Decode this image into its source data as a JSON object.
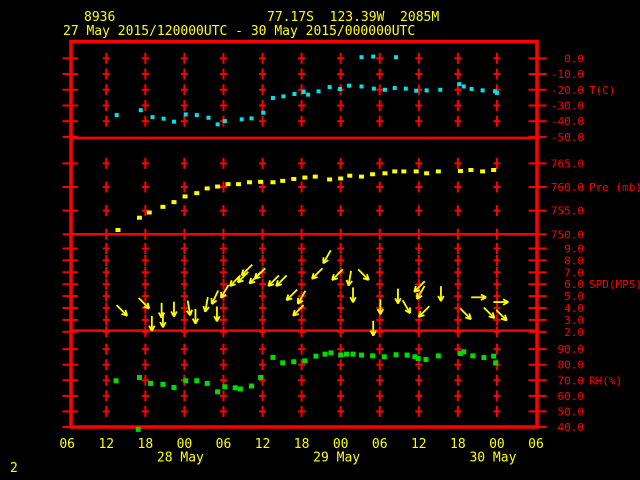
{
  "colors": {
    "background": "#000000",
    "grid": "#ff0000",
    "axis_text": "#ff0000",
    "label_text": "#ffff00",
    "temperature": "#00e1ea",
    "pressure": "#ffff00",
    "wind": "#ffff00",
    "humidity": "#00db00"
  },
  "chart_data": {
    "type": "scatter",
    "station_id": "8936",
    "location": "77.17S  123.39W  2085M",
    "period": "27 May 2015/120000UTC - 30 May 2015/000000UTC",
    "page_number": "2",
    "x_axis": {
      "hours_range": [
        0,
        72
      ],
      "tick_step_hours": 6,
      "tick_labels": [
        "06",
        "12",
        "18",
        "00",
        "06",
        "12",
        "18",
        "00",
        "06",
        "12",
        "18",
        "00",
        "06"
      ],
      "day_labels": [
        {
          "hour": 18,
          "label": "28 May"
        },
        {
          "hour": 42,
          "label": "29 May"
        },
        {
          "hour": 66,
          "label": "30 May"
        }
      ]
    },
    "panels": [
      {
        "name": "temperature",
        "unit_label": "T(C)",
        "unit_label_value": -20,
        "top_value": 10.7,
        "bottom_value": -50.6,
        "ticks": [
          {
            "label": "0.0",
            "value": 0
          },
          {
            "label": "-10.0",
            "value": -10
          },
          {
            "label": "-20.0",
            "value": -20
          },
          {
            "label": "-30.0",
            "value": -30
          },
          {
            "label": "-40.0",
            "value": -40
          },
          {
            "label": "-50.0",
            "value": -50
          }
        ],
        "grid_rows": [
          0,
          -10,
          -20,
          -30,
          -40
        ]
      },
      {
        "name": "pressure",
        "unit_label": "Pre (mb)",
        "unit_label_value": 760,
        "top_value": 770.4,
        "bottom_value": 750.0,
        "ticks": [
          {
            "label": "765.0",
            "value": 765
          },
          {
            "label": "760.0",
            "value": 760
          },
          {
            "label": "755.0",
            "value": 755
          },
          {
            "label": "750.0",
            "value": 750
          }
        ],
        "grid_rows": [
          765,
          760,
          755,
          750
        ]
      },
      {
        "name": "wind_speed",
        "unit_label": "SPD(MPS)",
        "unit_label_value": 6,
        "top_value": 10.2,
        "bottom_value": 2.1,
        "ticks": [
          {
            "label": "9.0",
            "value": 9
          },
          {
            "label": "8.0",
            "value": 8
          },
          {
            "label": "7.0",
            "value": 7
          },
          {
            "label": "6.0",
            "value": 6
          },
          {
            "label": "5.0",
            "value": 5
          },
          {
            "label": "4.0",
            "value": 4
          },
          {
            "label": "3.0",
            "value": 3
          },
          {
            "label": "2.0",
            "value": 2
          }
        ],
        "grid_rows": [
          9,
          8,
          7,
          6,
          5,
          4,
          3,
          2
        ]
      },
      {
        "name": "humidity",
        "unit_label": "RH(%)",
        "unit_label_value": 70,
        "top_value": 101.9,
        "bottom_value": 40.0,
        "ticks": [
          {
            "label": "90.0",
            "value": 90
          },
          {
            "label": "80.0",
            "value": 80
          },
          {
            "label": "70.0",
            "value": 70
          },
          {
            "label": "60.0",
            "value": 60
          },
          {
            "label": "50.0",
            "value": 50
          },
          {
            "label": "40.0",
            "value": 40
          }
        ],
        "grid_rows": [
          90,
          80,
          70,
          60,
          50
        ]
      }
    ],
    "series": {
      "temperature": {
        "panel": 0,
        "color": "#00e1ea",
        "marker": [
          4,
          4
        ],
        "points": [
          [
            7.6,
            -36.1
          ],
          [
            11.3,
            -33.0
          ],
          [
            13.1,
            -37.4
          ],
          [
            14.8,
            -38.4
          ],
          [
            16.4,
            -40.3
          ],
          [
            18.2,
            -35.7
          ],
          [
            19.9,
            -36.1
          ],
          [
            21.7,
            -37.8
          ],
          [
            23.1,
            -42.0
          ],
          [
            24.2,
            -39.9
          ],
          [
            26.8,
            -38.8
          ],
          [
            28.3,
            -38.2
          ],
          [
            30.1,
            -34.6
          ],
          [
            31.6,
            -25.2
          ],
          [
            33.2,
            -24.2
          ],
          [
            34.9,
            -22.7
          ],
          [
            36.3,
            -21.4
          ],
          [
            37.0,
            -23.1
          ],
          [
            38.6,
            -21.0
          ],
          [
            40.3,
            -18.3
          ],
          [
            41.9,
            -19.5
          ],
          [
            43.3,
            -17.4
          ],
          [
            45.2,
            -17.9
          ],
          [
            45.2,
            0.7
          ],
          [
            47.0,
            1.1
          ],
          [
            47.1,
            -19.3
          ],
          [
            48.8,
            -20.0
          ],
          [
            50.3,
            -18.9
          ],
          [
            50.5,
            0.7
          ],
          [
            52.0,
            -19.3
          ],
          [
            53.6,
            -20.6
          ],
          [
            55.2,
            -20.4
          ],
          [
            57.3,
            -20.0
          ],
          [
            60.2,
            -16.4
          ],
          [
            60.9,
            -17.9
          ],
          [
            62.1,
            -19.5
          ],
          [
            63.8,
            -20.4
          ],
          [
            65.7,
            -21.0
          ],
          [
            66.0,
            -22.0
          ]
        ]
      },
      "pressure": {
        "panel": 1,
        "color": "#ffff00",
        "marker": [
          5,
          4
        ],
        "points": [
          [
            7.8,
            750.9
          ],
          [
            11.1,
            753.5
          ],
          [
            12.6,
            754.6
          ],
          [
            14.7,
            755.8
          ],
          [
            16.4,
            756.8
          ],
          [
            18.1,
            758.0
          ],
          [
            19.9,
            758.7
          ],
          [
            21.5,
            759.7
          ],
          [
            23.1,
            760.1
          ],
          [
            24.7,
            760.6
          ],
          [
            26.3,
            760.6
          ],
          [
            28.0,
            761.0
          ],
          [
            29.7,
            761.1
          ],
          [
            31.6,
            761.0
          ],
          [
            33.1,
            761.3
          ],
          [
            34.8,
            761.7
          ],
          [
            36.5,
            762.0
          ],
          [
            38.1,
            762.2
          ],
          [
            40.3,
            761.6
          ],
          [
            42.0,
            761.8
          ],
          [
            43.4,
            762.4
          ],
          [
            45.2,
            762.2
          ],
          [
            46.9,
            762.7
          ],
          [
            48.8,
            762.9
          ],
          [
            50.3,
            763.3
          ],
          [
            51.7,
            763.3
          ],
          [
            53.6,
            763.3
          ],
          [
            55.2,
            762.9
          ],
          [
            57.0,
            763.3
          ],
          [
            60.4,
            763.4
          ],
          [
            62.0,
            763.6
          ],
          [
            63.8,
            763.3
          ],
          [
            65.5,
            763.6
          ]
        ]
      },
      "wind": {
        "panel": 2,
        "color": "#ffff00",
        "arrows": [
          [
            8.4,
            3.8,
            45
          ],
          [
            11.8,
            4.4,
            45
          ],
          [
            13.0,
            2.7,
            90
          ],
          [
            14.5,
            3.8,
            90
          ],
          [
            14.7,
            3.0,
            90
          ],
          [
            16.4,
            3.9,
            90
          ],
          [
            18.7,
            4.0,
            80
          ],
          [
            19.7,
            3.3,
            90
          ],
          [
            21.4,
            4.3,
            100
          ],
          [
            22.7,
            4.9,
            115
          ],
          [
            23.0,
            3.5,
            90
          ],
          [
            24.2,
            5.4,
            120
          ],
          [
            25.8,
            6.3,
            135
          ],
          [
            27.0,
            6.6,
            135
          ],
          [
            27.6,
            7.2,
            135
          ],
          [
            28.8,
            6.5,
            135
          ],
          [
            29.6,
            6.9,
            135
          ],
          [
            31.7,
            6.3,
            135
          ],
          [
            32.9,
            6.3,
            135
          ],
          [
            34.5,
            5.1,
            135
          ],
          [
            35.5,
            3.8,
            135
          ],
          [
            36.0,
            4.9,
            120
          ],
          [
            38.4,
            6.9,
            135
          ],
          [
            39.9,
            8.3,
            120
          ],
          [
            41.5,
            6.8,
            135
          ],
          [
            43.4,
            6.5,
            100
          ],
          [
            43.9,
            5.1,
            90
          ],
          [
            45.5,
            6.8,
            45
          ],
          [
            47.0,
            2.3,
            90
          ],
          [
            48.1,
            4.1,
            90
          ],
          [
            50.8,
            5.0,
            90
          ],
          [
            52.1,
            4.1,
            60
          ],
          [
            54.1,
            5.8,
            135
          ],
          [
            54.3,
            5.3,
            120
          ],
          [
            54.8,
            3.7,
            135
          ],
          [
            57.4,
            5.2,
            90
          ],
          [
            61.2,
            3.5,
            45
          ],
          [
            63.2,
            4.9,
            0
          ],
          [
            64.8,
            3.6,
            45
          ],
          [
            66.6,
            4.5,
            0
          ],
          [
            66.7,
            3.4,
            45
          ]
        ]
      },
      "humidity": {
        "panel": 3,
        "color": "#00db00",
        "marker": [
          5,
          5
        ],
        "points": [
          [
            7.5,
            69.7
          ],
          [
            10.9,
            38.5
          ],
          [
            11.1,
            71.8
          ],
          [
            12.8,
            68.0
          ],
          [
            14.7,
            67.4
          ],
          [
            16.4,
            65.4
          ],
          [
            18.2,
            69.7
          ],
          [
            19.9,
            69.7
          ],
          [
            21.5,
            68.0
          ],
          [
            23.1,
            62.6
          ],
          [
            24.2,
            65.8
          ],
          [
            25.8,
            65.2
          ],
          [
            26.6,
            64.4
          ],
          [
            28.3,
            66.3
          ],
          [
            29.7,
            71.8
          ],
          [
            31.6,
            84.7
          ],
          [
            33.1,
            81.2
          ],
          [
            34.8,
            81.9
          ],
          [
            36.5,
            82.5
          ],
          [
            38.2,
            85.5
          ],
          [
            39.6,
            86.8
          ],
          [
            40.5,
            87.6
          ],
          [
            42.0,
            86.2
          ],
          [
            42.9,
            86.8
          ],
          [
            43.9,
            86.8
          ],
          [
            45.2,
            86.2
          ],
          [
            46.9,
            85.7
          ],
          [
            48.7,
            85.1
          ],
          [
            50.5,
            86.4
          ],
          [
            52.2,
            86.2
          ],
          [
            53.4,
            85.1
          ],
          [
            53.9,
            84.0
          ],
          [
            55.1,
            83.4
          ],
          [
            57.0,
            85.7
          ],
          [
            60.4,
            87.2
          ],
          [
            60.9,
            88.3
          ],
          [
            62.3,
            85.7
          ],
          [
            64.0,
            84.6
          ],
          [
            65.5,
            85.5
          ],
          [
            65.8,
            81.2
          ]
        ]
      }
    }
  }
}
